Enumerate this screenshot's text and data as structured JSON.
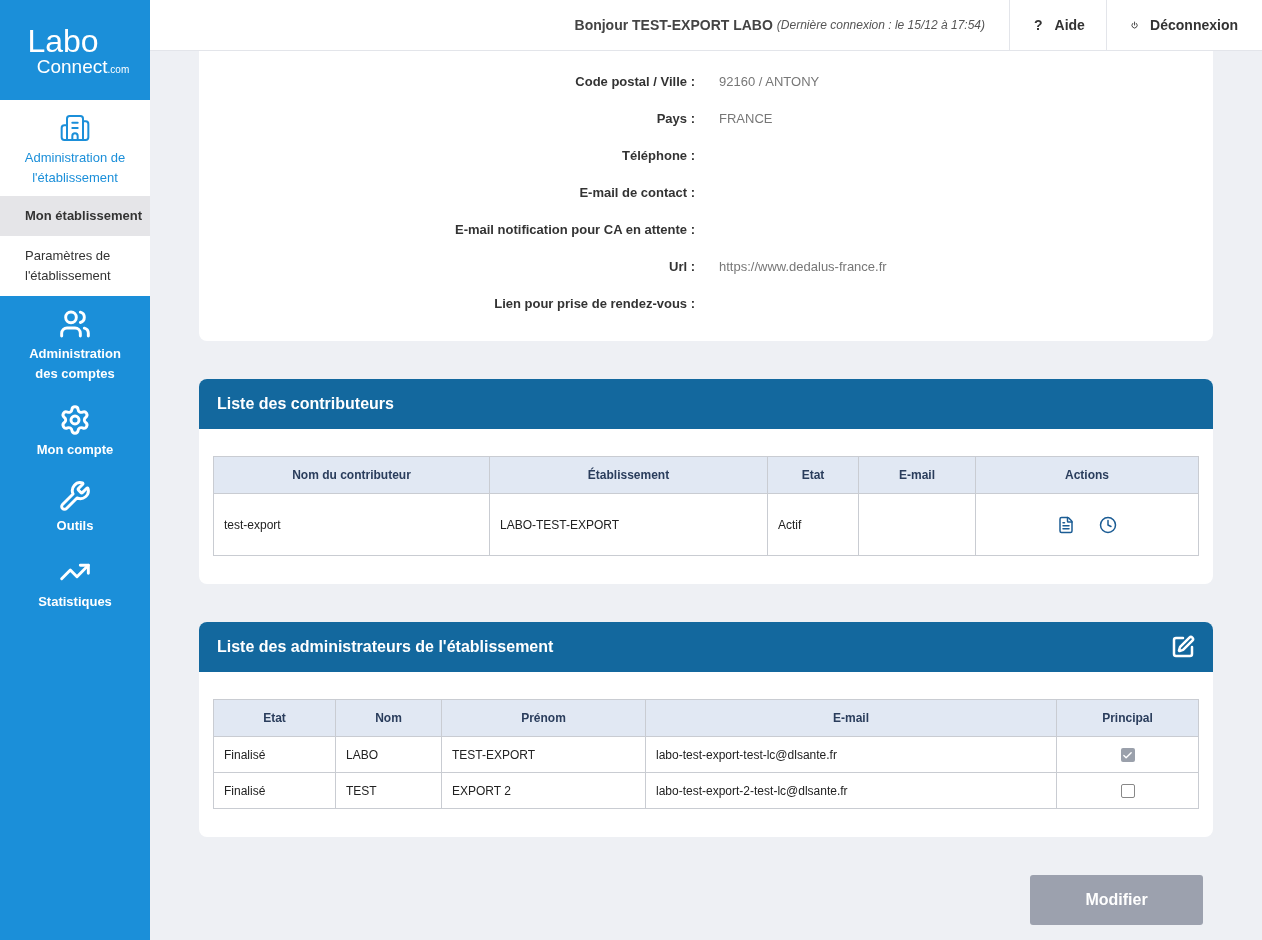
{
  "logo": {
    "line1": "Labo",
    "line2": "Connect",
    "suffix": ".com"
  },
  "sidebar": {
    "items": [
      {
        "label": "Administration de l'établissement",
        "kind": "building",
        "selected": true,
        "children": [
          {
            "label": "Mon établissement",
            "selected": true
          },
          {
            "label": "Paramètres de l'établissement",
            "selected": false
          }
        ]
      },
      {
        "label": "Administration des comptes",
        "kind": "users",
        "selected": false
      },
      {
        "label": "Mon compte",
        "kind": "gears",
        "selected": false
      },
      {
        "label": "Outils",
        "kind": "wrench",
        "selected": false
      },
      {
        "label": "Statistiques",
        "kind": "chart",
        "selected": false
      }
    ]
  },
  "header": {
    "greeting": "Bonjour TEST-EXPORT LABO",
    "last_login": "(Dernière connexion : le 15/12 à 17:54)",
    "buttons": [
      {
        "kind": "help",
        "icon": "?",
        "label": "Aide"
      },
      {
        "kind": "logout",
        "label": "Déconnexion"
      }
    ]
  },
  "details": [
    {
      "label": "Code postal / Ville :",
      "value": "92160 / ANTONY"
    },
    {
      "label": "Pays :",
      "value": "FRANCE"
    },
    {
      "label": "Téléphone :"
    },
    {
      "label": "E-mail de contact :"
    },
    {
      "label": "E-mail notification pour CA en attente :"
    },
    {
      "label": "Url :",
      "value": "https://www.dedalus-france.fr"
    },
    {
      "label": "Lien pour prise de rendez-vous :"
    }
  ],
  "contributors": {
    "title": "Liste des contributeurs",
    "columns": [
      "Nom du contributeur",
      "Établissement",
      "Etat",
      "E-mail",
      "Actions"
    ],
    "rows": [
      {
        "cells": [
          "test-export",
          "LABO-TEST-EXPORT",
          "Actif"
        ],
        "actions": [
          {
            "kind": "document"
          },
          {
            "kind": "history"
          }
        ]
      }
    ]
  },
  "administrators": {
    "title": "Liste des administrateurs de l'établissement",
    "columns": [
      "Etat",
      "Nom",
      "Prénom",
      "E-mail",
      "Principal"
    ],
    "rows": [
      {
        "cells": [
          "Finalisé",
          "LABO",
          "TEST-EXPORT",
          "labo-test-export-test-lc@dlsante.fr"
        ],
        "principal": true
      },
      {
        "cells": [
          "Finalisé",
          "TEST",
          "EXPORT 2",
          "labo-test-export-2-test-lc@dlsante.fr"
        ],
        "principal": false
      }
    ]
  },
  "submit": {
    "label": "Modifier",
    "disabled": true
  }
}
